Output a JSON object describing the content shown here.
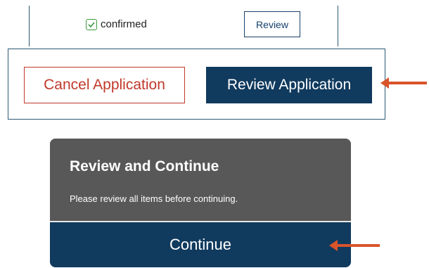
{
  "status_strip": {
    "badge_label": "confirmed",
    "badge_icon": "checkbox-check-icon",
    "review_label": "Review"
  },
  "actions": {
    "cancel_label": "Cancel Application",
    "review_label": "Review Application"
  },
  "review_card": {
    "title": "Review and Continue",
    "message": "Please review all items before continuing.",
    "continue_label": "Continue"
  },
  "colors": {
    "navy": "#103a5e",
    "cancel_red": "#c0392b",
    "arrow_orange": "#d9542b",
    "card_gray": "#585858",
    "check_green": "#3a9a3a"
  },
  "annotations": {
    "arrow_icon": "left-arrow-icon"
  }
}
